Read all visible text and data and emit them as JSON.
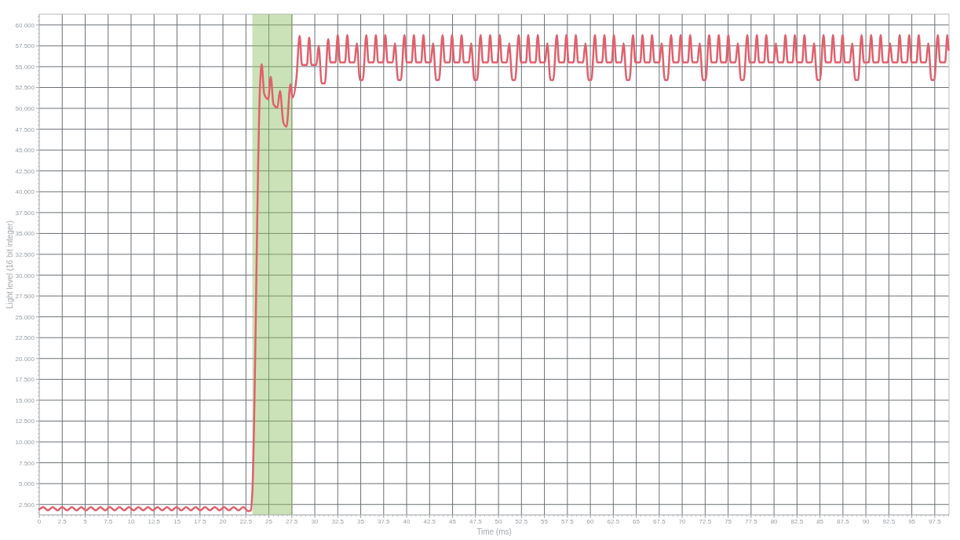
{
  "chart": {
    "chart_data": {
      "type": "line",
      "xlabel": "Time (ms)",
      "ylabel": "Light level (16 bit integer)",
      "xlim": [
        0,
        99.05
      ],
      "ylim": [
        1.25,
        61.3
      ],
      "grid": true,
      "xticks": [
        0,
        2.5,
        5,
        7.5,
        10,
        12.5,
        15,
        17.5,
        20,
        22.5,
        25,
        27.5,
        30,
        32.5,
        35,
        37.5,
        40,
        42.5,
        45,
        47.5,
        50,
        52.5,
        55,
        57.5,
        60,
        62.5,
        65,
        67.5,
        70,
        72.5,
        75,
        77.5,
        80,
        82.5,
        85,
        87.5,
        90,
        92.5,
        95,
        97.5
      ],
      "yticks": [
        {
          "value": 2.5,
          "label": "2.500"
        },
        {
          "value": 5,
          "label": "5.000"
        },
        {
          "value": 7.5,
          "label": "7.500"
        },
        {
          "value": 10,
          "label": "10.000"
        },
        {
          "value": 12.5,
          "label": "12.500"
        },
        {
          "value": 15,
          "label": "15.000"
        },
        {
          "value": 17.5,
          "label": "17.500"
        },
        {
          "value": 20,
          "label": "20.000"
        },
        {
          "value": 22.5,
          "label": "22.500"
        },
        {
          "value": 25,
          "label": "25.000"
        },
        {
          "value": 27.5,
          "label": "27.500"
        },
        {
          "value": 30,
          "label": "30.000"
        },
        {
          "value": 32.5,
          "label": "32.500"
        },
        {
          "value": 35,
          "label": "35.000"
        },
        {
          "value": 37.5,
          "label": "37.500"
        },
        {
          "value": 40,
          "label": "40.000"
        },
        {
          "value": 42.5,
          "label": "42.500"
        },
        {
          "value": 45,
          "label": "45.000"
        },
        {
          "value": 47.5,
          "label": "47.500"
        },
        {
          "value": 50,
          "label": "50.000"
        },
        {
          "value": 52.5,
          "label": "52.500"
        },
        {
          "value": 55,
          "label": "55.000"
        },
        {
          "value": 57.5,
          "label": "57.500"
        },
        {
          "value": 60,
          "label": "60.000"
        }
      ],
      "bands": [
        {
          "axis": "x",
          "from": 23.2,
          "to": 27.6
        }
      ],
      "x": [
        0,
        0.43,
        0.95,
        1.47,
        1.99,
        2.5,
        3.02,
        3.54,
        4.06,
        4.58,
        5.1,
        5.62,
        6.14,
        6.65,
        7.17,
        7.69,
        8.21,
        8.73,
        9.25,
        9.76,
        10.28,
        10.8,
        11.32,
        11.84,
        12.36,
        12.87,
        13.39,
        13.91,
        14.43,
        14.95,
        15.47,
        15.99,
        16.51,
        17.02,
        17.54,
        18.06,
        18.58,
        19.1,
        19.62,
        20.13,
        20.65,
        21.17,
        21.69,
        22.21,
        22.75,
        23.05,
        23.2,
        24.05,
        24.21,
        24.5,
        24.93,
        25.21,
        25.5,
        25.93,
        26.21,
        26.58,
        26.92,
        27.35,
        27.58,
        28,
        28.35,
        28.6,
        29.14,
        29.39,
        29.64,
        30.17,
        30.42,
        30.75,
        31.1,
        31.46,
        31.71,
        32.25,
        32.5,
        32.75,
        33.29,
        33.54,
        33.79,
        34.32,
        34.57,
        34.92,
        35.22,
        35.61,
        35.86,
        36.4,
        36.65,
        36.9,
        37.43,
        37.68,
        37.93,
        38.47,
        38.72,
        39.07,
        39.37,
        39.76,
        40.01,
        40.54,
        40.79,
        41.04,
        41.58,
        41.83,
        42.08,
        42.62,
        42.87,
        43.22,
        43.52,
        43.91,
        44.16,
        44.69,
        44.94,
        45.19,
        45.73,
        45.98,
        46.23,
        46.77,
        47.02,
        47.37,
        47.67,
        48.05,
        48.3,
        48.84,
        49.09,
        49.34,
        49.88,
        50.13,
        50.38,
        50.91,
        51.16,
        51.51,
        51.81,
        52.2,
        52.45,
        52.99,
        53.24,
        53.49,
        54.03,
        54.28,
        54.53,
        55.06,
        55.31,
        55.66,
        55.96,
        56.35,
        56.6,
        57.14,
        57.39,
        57.64,
        58.17,
        58.42,
        58.67,
        59.21,
        59.46,
        59.81,
        60.11,
        60.5,
        60.75,
        61.28,
        61.53,
        61.78,
        62.32,
        62.57,
        62.82,
        63.36,
        63.61,
        63.96,
        64.26,
        64.65,
        64.9,
        65.43,
        65.68,
        65.93,
        66.47,
        66.72,
        66.97,
        67.51,
        67.76,
        68.11,
        68.41,
        68.79,
        69.04,
        69.58,
        69.83,
        70.08,
        70.62,
        70.87,
        71.12,
        71.65,
        71.9,
        72.25,
        72.55,
        72.94,
        73.19,
        73.73,
        73.98,
        74.23,
        74.77,
        75.02,
        75.27,
        75.8,
        76.05,
        76.4,
        76.7,
        77.09,
        77.34,
        77.88,
        78.13,
        78.38,
        78.91,
        79.16,
        79.41,
        79.95,
        80.2,
        80.45,
        80.99,
        81.24,
        81.49,
        82.02,
        82.27,
        82.52,
        83.06,
        83.31,
        83.56,
        84.1,
        84.35,
        84.7,
        85,
        85.39,
        85.64,
        86.17,
        86.42,
        86.67,
        87.21,
        87.46,
        87.71,
        88.25,
        88.5,
        88.85,
        89.15,
        89.53,
        89.78,
        90.32,
        90.57,
        90.82,
        91.36,
        91.61,
        91.86,
        92.39,
        92.64,
        92.89,
        93.43,
        93.68,
        93.93,
        94.47,
        94.72,
        94.97,
        95.51,
        95.76,
        96.01,
        96.54,
        96.79,
        97.14,
        97.44,
        97.83,
        98.08,
        98.62,
        98.87,
        99
      ],
      "series": [
        {
          "color": "#e0606c",
          "values": [
            1.9,
            2.2,
            1.8,
            2.2,
            1.8,
            2.2,
            1.8,
            2.2,
            1.8,
            2.2,
            1.8,
            2.2,
            1.8,
            2.2,
            1.8,
            2.2,
            1.8,
            2.2,
            1.8,
            2.2,
            1.8,
            2.2,
            1.8,
            2.2,
            1.8,
            2.2,
            1.8,
            2.2,
            1.8,
            2.2,
            1.8,
            2.2,
            1.8,
            2.2,
            1.8,
            2.2,
            1.8,
            2.2,
            1.8,
            2.2,
            1.8,
            2.2,
            1.8,
            2.2,
            1.7,
            1.8,
            4,
            53,
            55.3,
            51.7,
            51.1,
            53.8,
            50.5,
            50.1,
            52.1,
            48.3,
            47.8,
            52.9,
            51.3,
            53.6,
            58.7,
            55.2,
            55.2,
            58.5,
            55.2,
            55.2,
            57.5,
            53,
            53,
            58.3,
            55.5,
            55.5,
            58.8,
            55.5,
            55.5,
            58.8,
            55.5,
            55.5,
            57.8,
            53.4,
            53.4,
            58.8,
            55.5,
            55.5,
            58.8,
            55.5,
            55.5,
            58.8,
            55.5,
            55.5,
            57.8,
            53.4,
            53.4,
            58.8,
            55.5,
            55.5,
            58.8,
            55.5,
            55.5,
            58.8,
            55.5,
            55.5,
            57.8,
            53.4,
            53.4,
            58.8,
            55.5,
            55.5,
            58.8,
            55.5,
            55.5,
            58.8,
            55.5,
            55.5,
            57.8,
            53.4,
            53.4,
            58.8,
            55.5,
            55.5,
            58.8,
            55.5,
            55.5,
            58.8,
            55.5,
            55.5,
            57.8,
            53.4,
            53.4,
            58.8,
            55.5,
            55.5,
            58.8,
            55.5,
            55.5,
            58.8,
            55.5,
            55.5,
            57.8,
            53.4,
            53.4,
            58.8,
            55.5,
            55.5,
            58.8,
            55.5,
            55.5,
            58.8,
            55.5,
            55.5,
            57.8,
            53.4,
            53.4,
            58.8,
            55.5,
            55.5,
            58.8,
            55.5,
            55.5,
            58.8,
            55.5,
            55.5,
            57.8,
            53.4,
            53.4,
            58.8,
            55.5,
            55.5,
            58.8,
            55.5,
            55.5,
            58.8,
            55.5,
            55.5,
            57.8,
            53.4,
            53.4,
            58.8,
            55.5,
            55.5,
            58.8,
            55.5,
            55.5,
            58.8,
            55.5,
            55.5,
            57.8,
            53.4,
            53.4,
            58.8,
            55.5,
            55.5,
            58.8,
            55.5,
            55.5,
            58.8,
            55.5,
            55.5,
            57.8,
            53.4,
            53.4,
            58.8,
            55.5,
            55.5,
            58.8,
            55.5,
            55.5,
            58.8,
            55.5,
            55.5,
            57.8,
            55.5,
            55.5,
            58.8,
            55.5,
            55.5,
            58.8,
            55.5,
            55.5,
            58.8,
            55.5,
            55.5,
            57.8,
            53.4,
            53.4,
            58.8,
            55.5,
            55.5,
            58.8,
            55.5,
            55.5,
            58.8,
            55.5,
            55.5,
            57.8,
            53.4,
            53.4,
            58.8,
            55.5,
            55.5,
            58.8,
            55.5,
            55.5,
            58.8,
            55.5,
            55.5,
            57.8,
            55.5,
            55.5,
            58.8,
            55.5,
            55.5,
            58.8,
            55.5,
            55.5,
            58.8,
            55.5,
            55.5,
            57.8,
            53.4,
            53.4,
            58.8,
            55.5,
            55.5,
            58.8,
            57
          ]
        }
      ]
    }
  }
}
